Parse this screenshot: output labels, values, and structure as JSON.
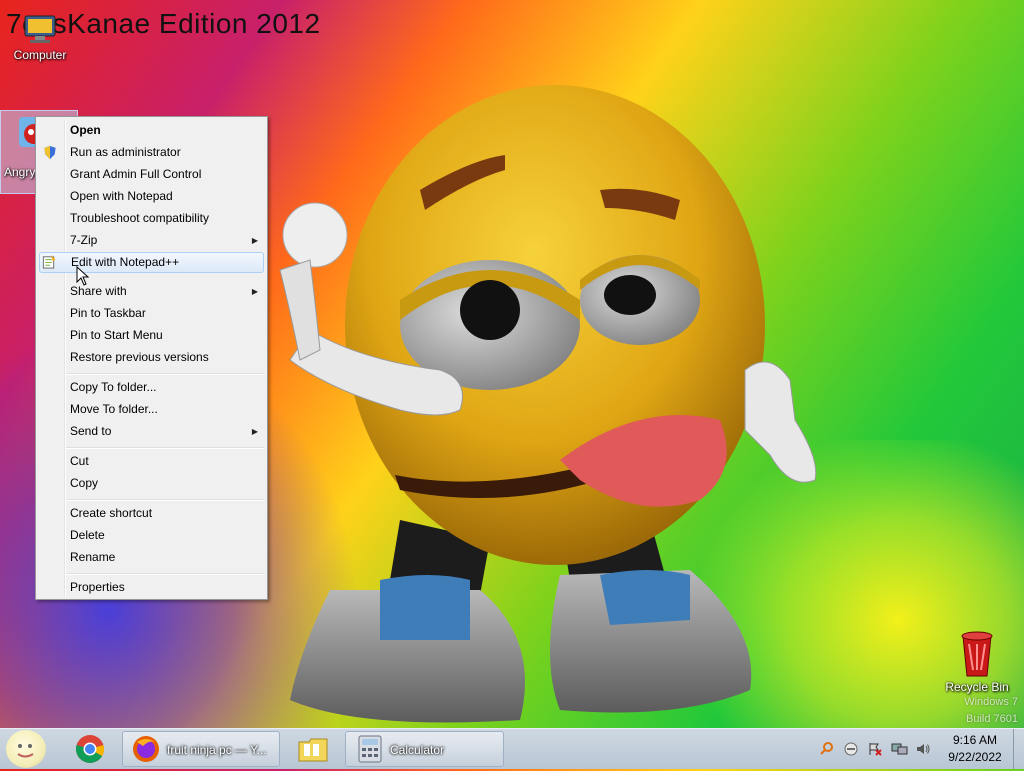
{
  "desktop": {
    "banner": "7ossKanae Edition 2012",
    "icons": {
      "computer": "Computer",
      "angry": "Angry",
      "recycle_bin": "Recycle Bin"
    },
    "watermark": {
      "line1": "Windows 7",
      "line2": "Build 7601"
    }
  },
  "context_menu": {
    "items": [
      {
        "label": "Open",
        "bold": true
      },
      {
        "label": "Run as administrator",
        "icon": "shield-icon"
      },
      {
        "label": "Grant Admin Full Control"
      },
      {
        "label": "Open with Notepad"
      },
      {
        "label": "Troubleshoot compatibility"
      },
      {
        "label": "7-Zip",
        "submenu": true
      },
      {
        "label": "Edit with Notepad++",
        "icon": "notepad-plus-plus-icon",
        "highlighted": true
      },
      {
        "label": "Share with",
        "submenu": true
      },
      {
        "label": "Pin to Taskbar"
      },
      {
        "label": "Pin to Start Menu"
      },
      {
        "label": "Restore previous versions"
      },
      {
        "label": "Copy To folder..."
      },
      {
        "label": "Move To folder..."
      },
      {
        "label": "Send to",
        "submenu": true
      },
      {
        "label": "Cut"
      },
      {
        "label": "Copy"
      },
      {
        "label": "Create shortcut"
      },
      {
        "label": "Delete"
      },
      {
        "label": "Rename"
      },
      {
        "label": "Properties"
      }
    ],
    "submenu_arrow": "▶"
  },
  "taskbar": {
    "firefox_title": "fruit ninja pc — Y...",
    "calculator_title": "Calculator",
    "clock_time": "9:16 AM",
    "clock_date": "9/22/2022"
  },
  "colors": {
    "menu_bg": "#f0f0f0",
    "highlight_border": "#aecff7",
    "taskbar": "#c4d0dc"
  }
}
